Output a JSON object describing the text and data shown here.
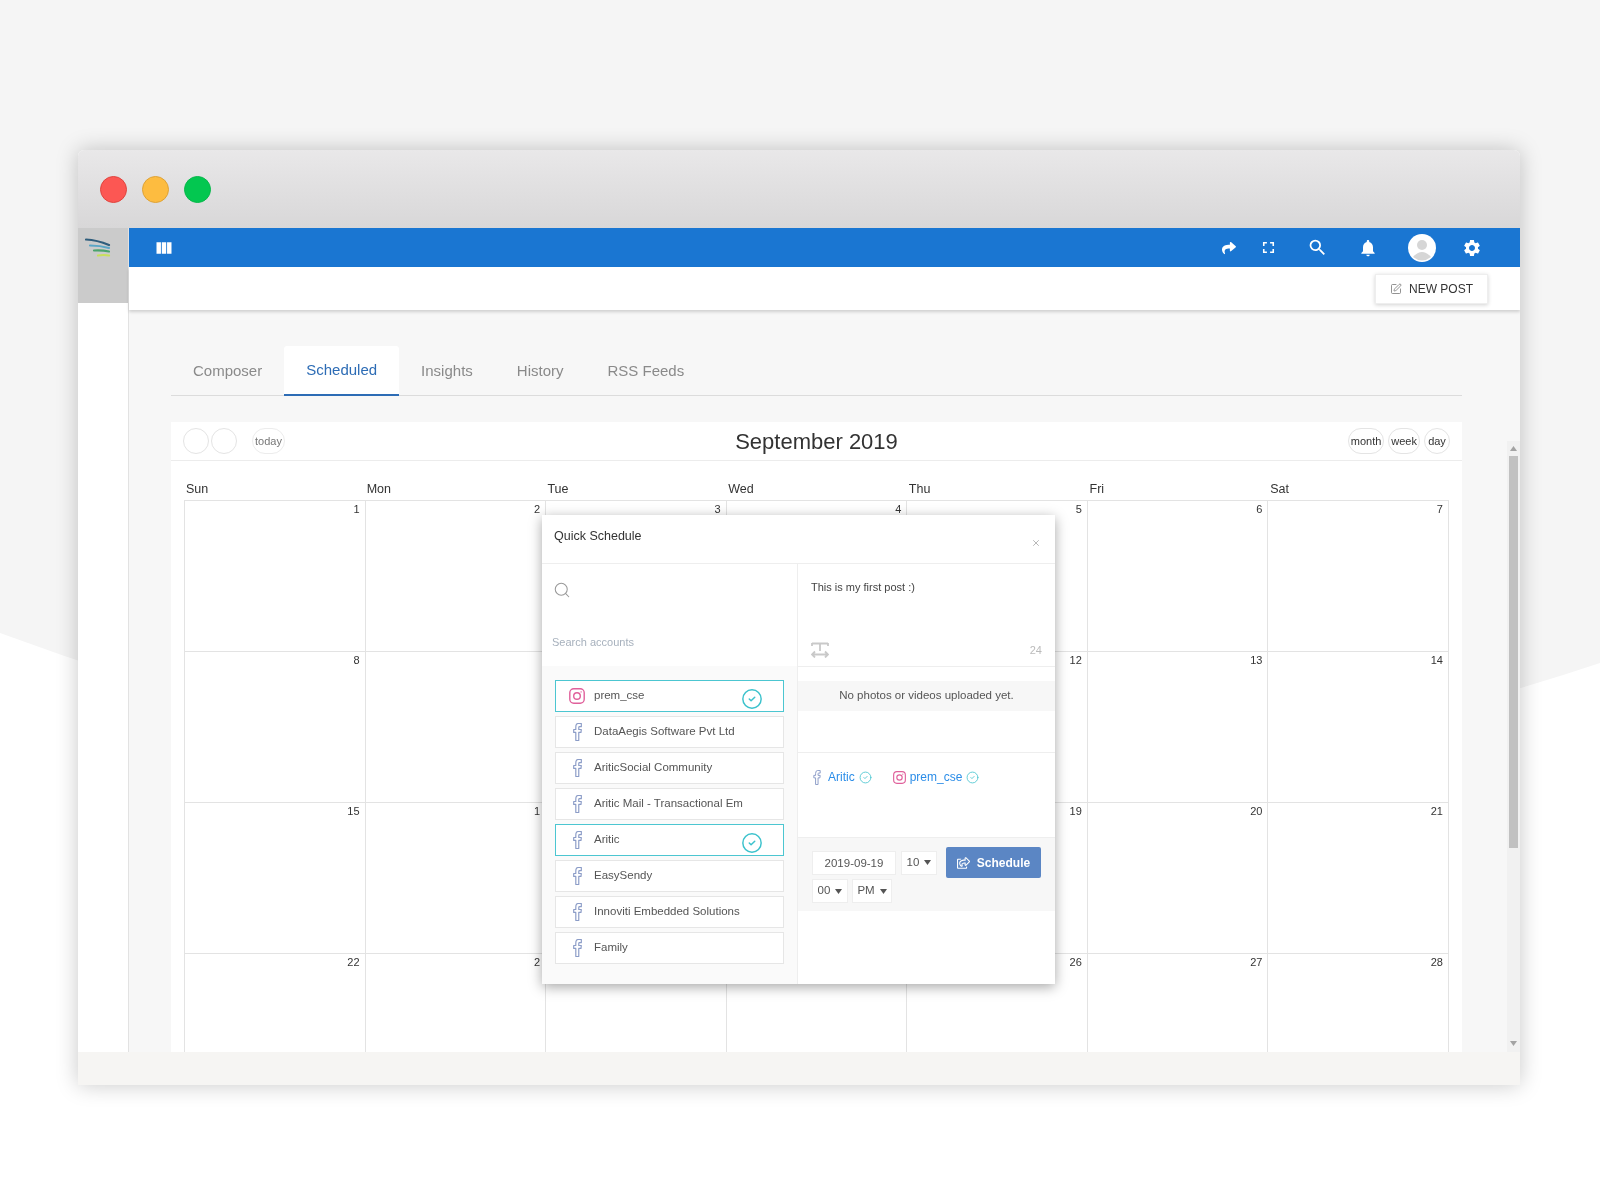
{
  "action_bar": {
    "new_post": "NEW POST"
  },
  "tabs": [
    {
      "label": "Composer",
      "selected": false
    },
    {
      "label": "Scheduled",
      "selected": true
    },
    {
      "label": "Insights",
      "selected": false
    },
    {
      "label": "History",
      "selected": false
    },
    {
      "label": "RSS Feeds",
      "selected": false
    }
  ],
  "calendar": {
    "today": "today",
    "title": "September 2019",
    "views": [
      "month",
      "week",
      "day"
    ],
    "weekdays": [
      "Sun",
      "Mon",
      "Tue",
      "Wed",
      "Thu",
      "Fri",
      "Sat"
    ],
    "weeks": [
      {
        "sun": "1",
        "mon": "2",
        "tue": "3",
        "wed": "4",
        "thu": "5",
        "fri": "6",
        "sat": "7"
      },
      {
        "sun": "8",
        "thu": "12",
        "fri": "13",
        "sat": "14"
      },
      {
        "sun": "15",
        "mon": "1",
        "thu": "19",
        "fri": "20",
        "sat": "21"
      },
      {
        "sun": "22",
        "mon": "2",
        "thu": "26",
        "fri": "27",
        "sat": "28"
      }
    ]
  },
  "quick_schedule": {
    "title": "Quick Schedule",
    "search": {
      "placeholder": "Search accounts"
    },
    "accounts": [
      {
        "name": "prem_cse",
        "kind": "instagram",
        "selected": true
      },
      {
        "name": "DataAegis Software Pvt Ltd",
        "kind": "facebook",
        "selected": false
      },
      {
        "name": "AriticSocial Community",
        "kind": "facebook",
        "selected": false
      },
      {
        "name": "Aritic Mail - Transactional Em",
        "kind": "facebook",
        "selected": false
      },
      {
        "name": "Aritic",
        "kind": "facebook",
        "selected": true
      },
      {
        "name": "EasySendy",
        "kind": "facebook",
        "selected": false
      },
      {
        "name": "Innoviti Embedded Solutions",
        "kind": "facebook",
        "selected": false
      },
      {
        "name": "Family",
        "kind": "facebook",
        "selected": false
      }
    ],
    "post": {
      "value": "This is my first post :)",
      "count": "24"
    },
    "media_message": "No photos or videos uploaded yet.",
    "selected_accounts": [
      {
        "name": "Aritic",
        "kind": "facebook"
      },
      {
        "name": "prem_cse",
        "kind": "instagram"
      }
    ],
    "date": {
      "value": "2019-09-19"
    },
    "hour": {
      "value": "10"
    },
    "minute": {
      "value": "00"
    },
    "period": {
      "value": "PM"
    },
    "schedule_button": "Schedule"
  }
}
